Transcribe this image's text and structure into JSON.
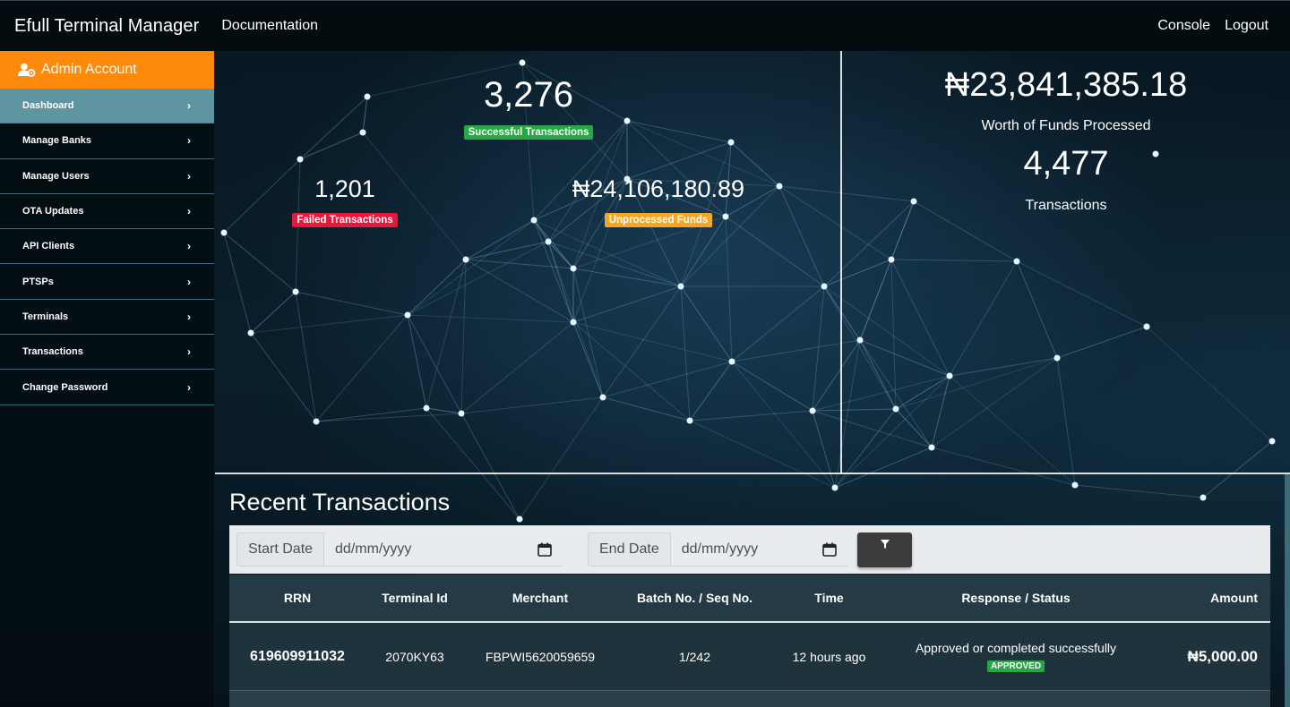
{
  "topnav": {
    "brand": "Efull Terminal Manager",
    "documentation": "Documentation",
    "console": "Console",
    "logout": "Logout"
  },
  "sidebar": {
    "account": "Admin Account",
    "items": [
      {
        "label": "Dashboard"
      },
      {
        "label": "Manage Banks"
      },
      {
        "label": "Manage Users"
      },
      {
        "label": "OTA Updates"
      },
      {
        "label": "API Clients"
      },
      {
        "label": "PTSPs"
      },
      {
        "label": "Terminals"
      },
      {
        "label": "Transactions"
      },
      {
        "label": "Change Password"
      }
    ],
    "chevron": "›"
  },
  "stats": {
    "successful": {
      "value": "3,276",
      "label": "Successful Transactions"
    },
    "failed": {
      "value": "1,201",
      "label": "Failed Transactions"
    },
    "unprocessed": {
      "value": "₦24,106,180.89",
      "label": "Unprocessed Funds"
    },
    "funds": {
      "value": "₦23,841,385.18",
      "label": "Worth of Funds Processed"
    },
    "transactions": {
      "value": "4,477",
      "label": "Transactions"
    }
  },
  "recent": {
    "title": "Recent Transactions",
    "start_date_label": "Start Date",
    "end_date_label": "End Date",
    "date_placeholder": "dd/mm/yyyy",
    "columns": [
      "RRN",
      "Terminal Id",
      "Merchant",
      "Batch No. / Seq No.",
      "Time",
      "Response / Status",
      "Amount"
    ],
    "rows": [
      {
        "rrn": "619609911032",
        "terminal_id": "2070KY63",
        "merchant": "FBPWI5620059659",
        "batch_seq": "1/242",
        "time": "12 hours ago",
        "response": "Approved or completed successfully",
        "status": "APPROVED",
        "amount": "₦5,000.00"
      }
    ]
  },
  "colors": {
    "accent_orange": "#fe8a0c",
    "active_item": "#5e95a1",
    "success": "#28a745",
    "danger": "#e8173c",
    "warning": "#f6a623"
  },
  "icons": [
    "user-cog-icon",
    "chevron-right-icon",
    "calendar-icon",
    "filter-icon"
  ]
}
